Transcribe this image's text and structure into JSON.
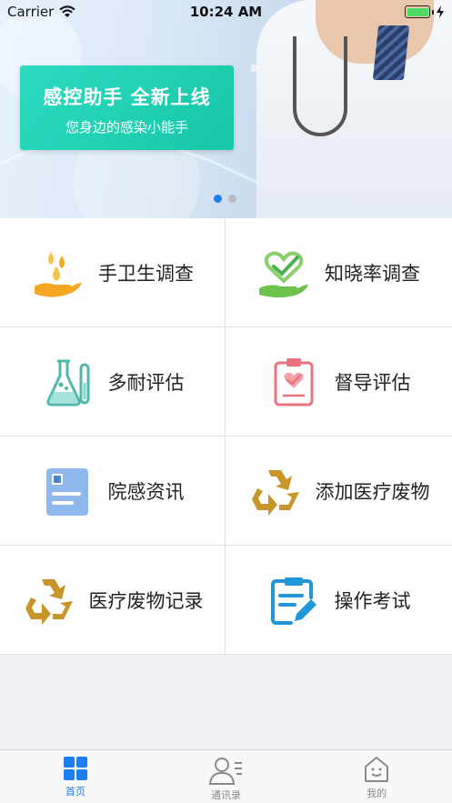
{
  "status_bar": {
    "carrier": "Carrier",
    "time": "10:24 AM"
  },
  "banner": {
    "title": "感控助手  全新上线",
    "subtitle": "您身边的感染小能手",
    "accent": "#1ec9ad",
    "page_count": 2,
    "active_page": 1
  },
  "menu": [
    {
      "label": "手卫生调查",
      "icon": "hand-hygiene-icon"
    },
    {
      "label": "知晓率调查",
      "icon": "heart-hand-icon"
    },
    {
      "label": "多耐评估",
      "icon": "flask-icon"
    },
    {
      "label": "督导评估",
      "icon": "clipboard-heart-icon"
    },
    {
      "label": "院感资讯",
      "icon": "news-document-icon"
    },
    {
      "label": "添加医疗废物",
      "icon": "recycle-icon"
    },
    {
      "label": "医疗废物记录",
      "icon": "recycle-icon"
    },
    {
      "label": "操作考试",
      "icon": "edit-document-icon"
    }
  ],
  "tabbar": {
    "active_color": "#1c7ef0",
    "items": [
      {
        "label": "首页",
        "icon": "home-grid-icon"
      },
      {
        "label": "通讯录",
        "icon": "contacts-icon"
      },
      {
        "label": "我的",
        "icon": "profile-house-icon"
      }
    ]
  }
}
